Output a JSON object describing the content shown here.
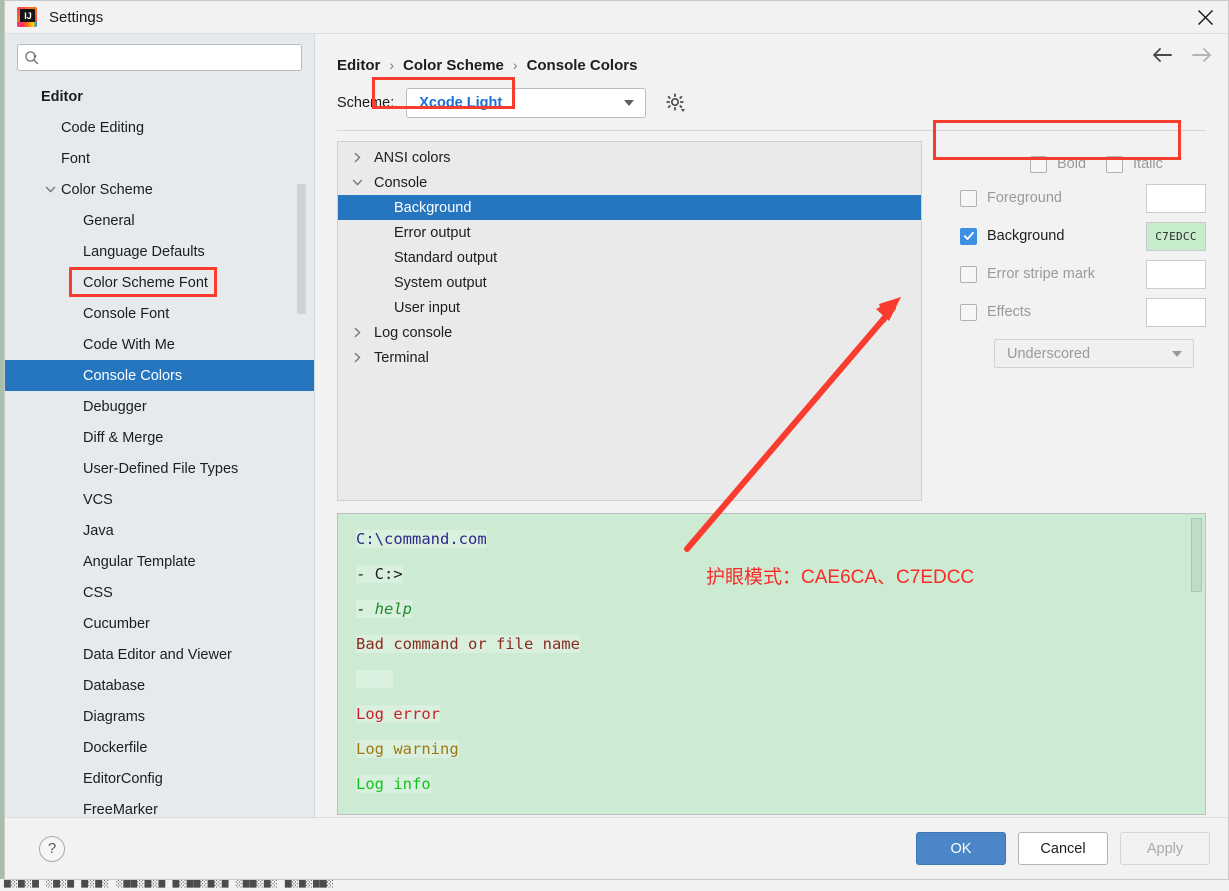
{
  "window": {
    "title": "Settings",
    "app_icon": "intellij-idea-logo",
    "close_icon": "close-icon"
  },
  "sidebar": {
    "search": {
      "placeholder": "",
      "value": "",
      "icon": "search-icon"
    },
    "items": [
      {
        "label": "Editor",
        "level": 0,
        "arrow": "none",
        "selected": false
      },
      {
        "label": "Code Editing",
        "level": 1,
        "arrow": "none",
        "selected": false
      },
      {
        "label": "Font",
        "level": 1,
        "arrow": "none",
        "selected": false
      },
      {
        "label": "Color Scheme",
        "level": 1,
        "arrow": "expanded",
        "selected": false
      },
      {
        "label": "General",
        "level": 2,
        "arrow": "none",
        "selected": false
      },
      {
        "label": "Language Defaults",
        "level": 2,
        "arrow": "none",
        "selected": false
      },
      {
        "label": "Color Scheme Font",
        "level": 2,
        "arrow": "none",
        "selected": false
      },
      {
        "label": "Console Font",
        "level": 2,
        "arrow": "none",
        "selected": false
      },
      {
        "label": "Code With Me",
        "level": 2,
        "arrow": "none",
        "selected": false
      },
      {
        "label": "Console Colors",
        "level": 2,
        "arrow": "none",
        "selected": true
      },
      {
        "label": "Debugger",
        "level": 2,
        "arrow": "none",
        "selected": false
      },
      {
        "label": "Diff & Merge",
        "level": 2,
        "arrow": "none",
        "selected": false
      },
      {
        "label": "User-Defined File Types",
        "level": 2,
        "arrow": "none",
        "selected": false
      },
      {
        "label": "VCS",
        "level": 2,
        "arrow": "none",
        "selected": false
      },
      {
        "label": "Java",
        "level": 2,
        "arrow": "none",
        "selected": false
      },
      {
        "label": "Angular Template",
        "level": 2,
        "arrow": "none",
        "selected": false
      },
      {
        "label": "CSS",
        "level": 2,
        "arrow": "none",
        "selected": false
      },
      {
        "label": "Cucumber",
        "level": 2,
        "arrow": "none",
        "selected": false
      },
      {
        "label": "Data Editor and Viewer",
        "level": 2,
        "arrow": "none",
        "selected": false
      },
      {
        "label": "Database",
        "level": 2,
        "arrow": "none",
        "selected": false
      },
      {
        "label": "Diagrams",
        "level": 2,
        "arrow": "none",
        "selected": false
      },
      {
        "label": "Dockerfile",
        "level": 2,
        "arrow": "none",
        "selected": false
      },
      {
        "label": "EditorConfig",
        "level": 2,
        "arrow": "none",
        "selected": false
      },
      {
        "label": "FreeMarker",
        "level": 2,
        "arrow": "none",
        "selected": false
      }
    ]
  },
  "breadcrumb": {
    "items": [
      "Editor",
      "Color Scheme",
      "Console Colors"
    ],
    "separator": "›",
    "back_icon": "arrow-left-icon",
    "forward_icon": "arrow-right-icon"
  },
  "scheme": {
    "label": "Scheme:",
    "value": "Xcode Light",
    "gear_icon": "gear-icon",
    "dropdown_icon": "chevron-down-icon"
  },
  "color_tree": {
    "items": [
      {
        "label": "ANSI colors",
        "level": 0,
        "arrow": "collapsed",
        "selected": false
      },
      {
        "label": "Console",
        "level": 0,
        "arrow": "expanded",
        "selected": false
      },
      {
        "label": "Background",
        "level": 1,
        "arrow": "none",
        "selected": true
      },
      {
        "label": "Error output",
        "level": 1,
        "arrow": "none",
        "selected": false
      },
      {
        "label": "Standard output",
        "level": 1,
        "arrow": "none",
        "selected": false
      },
      {
        "label": "System output",
        "level": 1,
        "arrow": "none",
        "selected": false
      },
      {
        "label": "User input",
        "level": 1,
        "arrow": "none",
        "selected": false
      },
      {
        "label": "Log console",
        "level": 0,
        "arrow": "collapsed",
        "selected": false
      },
      {
        "label": "Terminal",
        "level": 0,
        "arrow": "collapsed",
        "selected": false
      }
    ]
  },
  "attributes": {
    "bold": {
      "label": "Bold",
      "checked": false,
      "enabled": false
    },
    "italic": {
      "label": "Italic",
      "checked": false,
      "enabled": false
    },
    "rows": [
      {
        "label": "Foreground",
        "checked": false,
        "enabled": false,
        "swatch_value": "",
        "swatch_color": "#ffffff"
      },
      {
        "label": "Background",
        "checked": true,
        "enabled": true,
        "swatch_value": "C7EDCC",
        "swatch_color": "#c7edcc"
      },
      {
        "label": "Error stripe mark",
        "checked": false,
        "enabled": false,
        "swatch_value": "",
        "swatch_color": "#ffffff"
      },
      {
        "label": "Effects",
        "checked": false,
        "enabled": false,
        "swatch_value": "",
        "swatch_color": "#ffffff"
      }
    ],
    "effect_type": {
      "value": "Underscored",
      "dropdown_icon": "chevron-down-icon"
    }
  },
  "preview": {
    "background_color": "#cdebd2",
    "lines": [
      {
        "segments": [
          {
            "text": "C:\\command.com",
            "color": "#2a2a88",
            "highlight": true
          }
        ]
      },
      {
        "segments": [
          {
            "text": "- C:>",
            "color": "#1d1d1d",
            "highlight": true
          }
        ]
      },
      {
        "segments": [
          {
            "text": "- ",
            "color": "#1d1d1d",
            "highlight": true
          },
          {
            "text": "help",
            "color": "#1f8c2e",
            "highlight": true,
            "italic": true
          }
        ]
      },
      {
        "segments": [
          {
            "text": "Bad command or file name",
            "color": "#8a2b1f",
            "highlight": true
          }
        ]
      },
      {
        "segments": [
          {
            "text": "",
            "color": "#1d1d1d",
            "highlight": true
          }
        ]
      },
      {
        "segments": [
          {
            "text": "Log error",
            "color": "#cc2027",
            "highlight": true
          }
        ]
      },
      {
        "segments": [
          {
            "text": "Log warning",
            "color": "#9c7a10",
            "highlight": true
          }
        ]
      },
      {
        "segments": [
          {
            "text": "Log info",
            "color": "#12c21e",
            "highlight": true
          }
        ]
      }
    ]
  },
  "annotations": {
    "red_note": "护眼模式：CAE6CA、C7EDCC",
    "red_color": "#fa2a28",
    "arrow": "red-arrow-annotation",
    "highlight_boxes": [
      "sidebar-console-colors",
      "tree-background",
      "attr-background-row"
    ]
  },
  "buttons": {
    "help": "?",
    "ok": "OK",
    "cancel": "Cancel",
    "apply": "Apply"
  },
  "background_page": {
    "bottom_text": "█░█░█  ░█░█  █░█░   ░██░█░█  █░██░█░█  ░██░█░   █░█░██░"
  }
}
